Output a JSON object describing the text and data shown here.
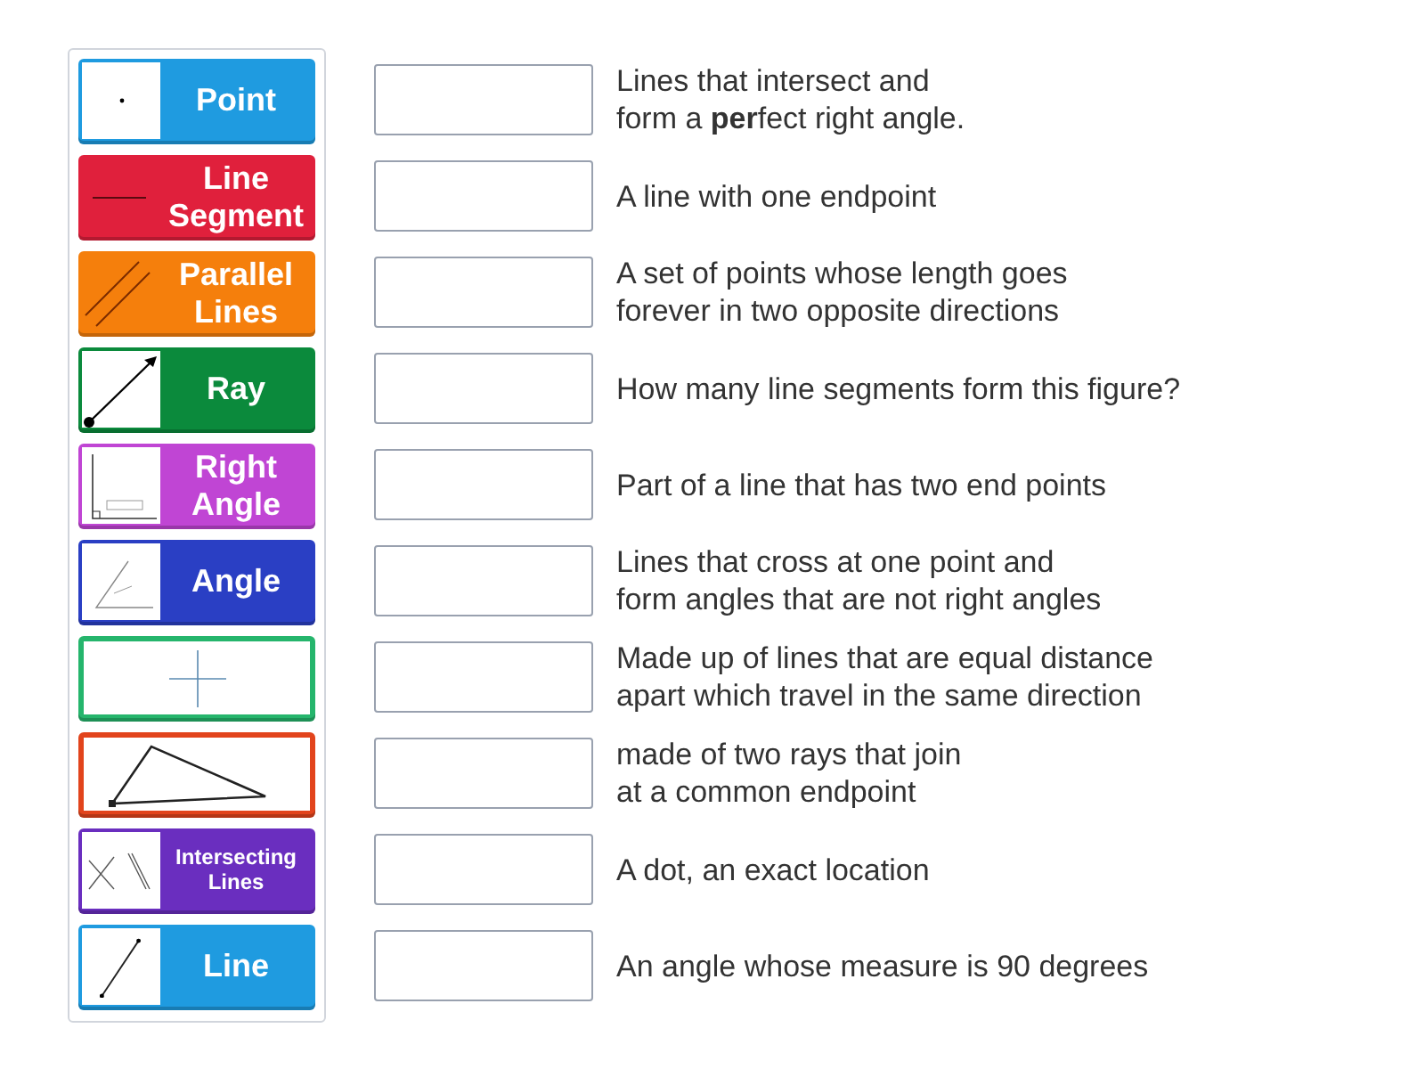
{
  "tiles": [
    {
      "kind": "image_label",
      "label": "Point",
      "color": "#1f9be0"
    },
    {
      "kind": "inline_label",
      "label": "Line Segment",
      "color": "#e0203c"
    },
    {
      "kind": "inline_label",
      "label": "Parallel Lines",
      "color": "#f57f0c"
    },
    {
      "kind": "image_label",
      "label": "Ray",
      "color": "#0b8a3c"
    },
    {
      "kind": "image_label",
      "label": "Right Angle",
      "color": "#c045d4"
    },
    {
      "kind": "image_label",
      "label": "Angle",
      "color": "#2a3fc4"
    },
    {
      "kind": "image_only",
      "color": "#25b56c"
    },
    {
      "kind": "image_only",
      "color": "#e2441c"
    },
    {
      "kind": "image_label",
      "label": "Intersecting Lines",
      "color": "#6a2ebf"
    },
    {
      "kind": "image_label",
      "label": "Line",
      "color": "#1f9be0"
    }
  ],
  "clues": [
    "Lines that intersect and\nform a **per**fect right angle.",
    "A line with one endpoint",
    "A set of points whose length goes\nforever in two opposite directions",
    "How many line segments form this figure?",
    "Part of a line that has two end points",
    "Lines that cross at one point and\nform angles that are not right angles",
    "Made up of lines that are equal distance\napart which travel in the same direction",
    "made of two rays that join\nat a common endpoint",
    "A dot, an exact location",
    "An angle whose measure is 90 degrees"
  ]
}
